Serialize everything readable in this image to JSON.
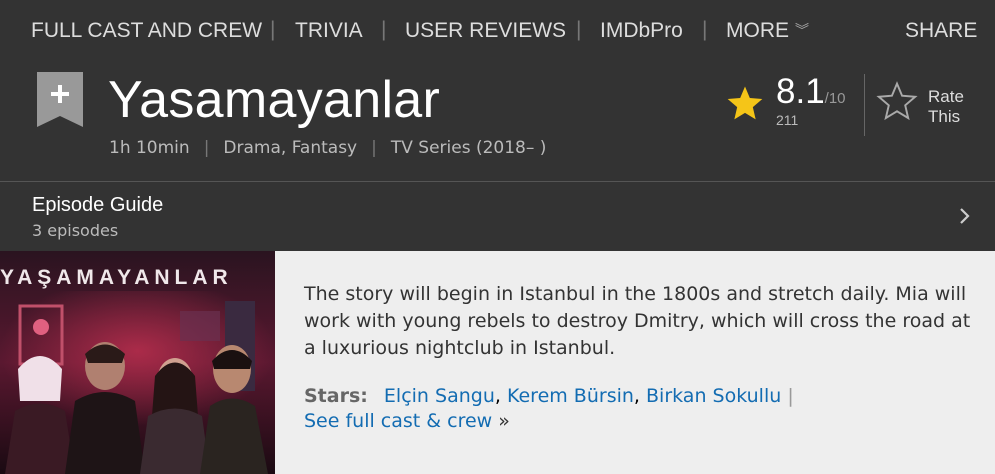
{
  "nav": {
    "full_cast": "FULL CAST AND CREW",
    "trivia": "TRIVIA",
    "user_reviews": "USER REVIEWS",
    "imdbpro": "IMDbPro",
    "more": "MORE",
    "share": "SHARE"
  },
  "title": "Yasamayanlar",
  "meta": {
    "runtime": "1h 10min",
    "genres": "Drama, Fantasy",
    "type": "TV Series (2018– )"
  },
  "rating": {
    "value": "8.1",
    "max": "/10",
    "count": "211",
    "rate_line1": "Rate",
    "rate_line2": "This",
    "star_color": "#f5c518"
  },
  "episode_guide": {
    "title": "Episode Guide",
    "count": "3 episodes"
  },
  "poster": {
    "text": "YAŞAMAYANLAR"
  },
  "plot": "The story will begin in Istanbul in the 1800s and stretch daily. Mia will work with young rebels to destroy Dmitry, which will cross the road at a luxurious nightclub in Istanbul.",
  "stars": {
    "label": "Stars:",
    "names": [
      "Elçin Sangu",
      "Kerem Bürsin",
      "Birkan Sokullu"
    ],
    "see_all": "See full cast & crew",
    "see_all_arrow": "»"
  },
  "colors": {
    "link": "#136cb2",
    "header_bg": "#333333",
    "plot_bg": "#eeeeee"
  }
}
